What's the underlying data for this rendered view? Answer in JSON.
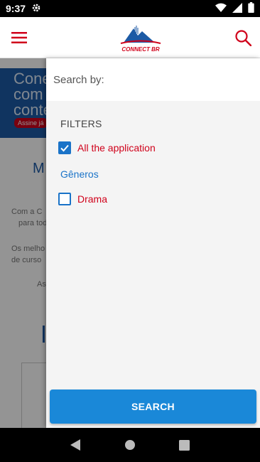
{
  "status_bar": {
    "time": "9:37",
    "icons": [
      "settings-icon",
      "wifi-icon",
      "signal-icon",
      "battery-icon"
    ]
  },
  "app_bar": {
    "logo_text": "CONNECT BR",
    "menu_icon": "hamburger-menu-icon",
    "search_icon": "search-icon",
    "accent_color": "#d0021b"
  },
  "background": {
    "hero_lines": [
      "Cone",
      "com c",
      "conte"
    ],
    "hero_badge": "Assine já",
    "section_title": "M",
    "text_lines": [
      "Com a C",
      "para tod",
      "Os melho",
      "de curso",
      "As"
    ]
  },
  "drawer": {
    "search_label": "Search by:",
    "filters_heading": "FILTERS",
    "options": [
      {
        "label": "All the application",
        "checked": true
      }
    ],
    "group_heading": "Gêneros",
    "group_options": [
      {
        "label": "Drama",
        "checked": false
      }
    ],
    "search_button": "SEARCH",
    "checkbox_color": "#1a73c8",
    "button_color": "#1a88d8"
  },
  "nav_bar": {
    "icons": [
      "back-icon",
      "home-icon",
      "recents-icon"
    ]
  }
}
